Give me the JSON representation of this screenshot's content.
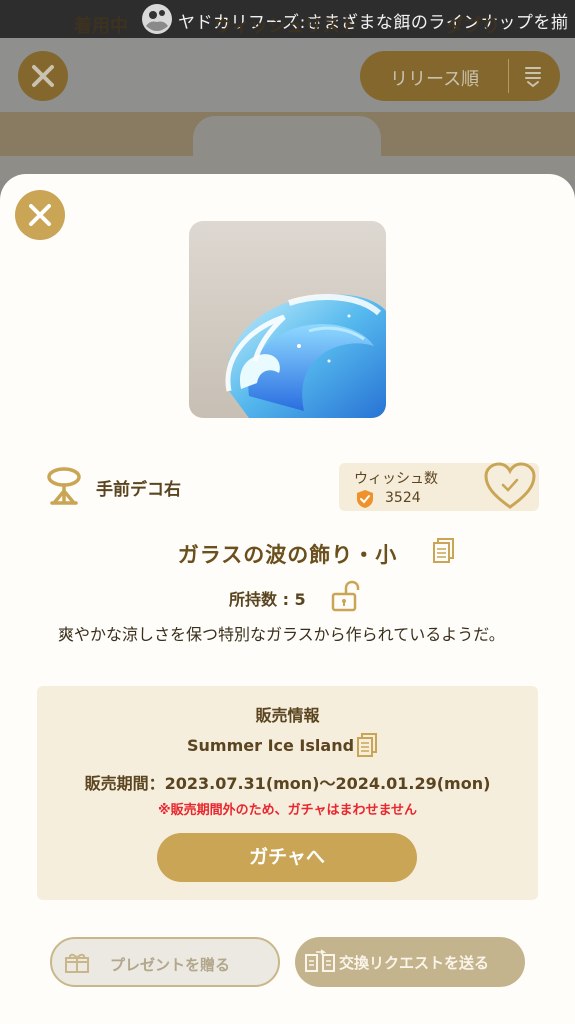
{
  "banner": {
    "text": "ヤドカリフーズ:さまざまな餌のラインナップを揃"
  },
  "background": {
    "sort_label": "リリース順",
    "tabs": [
      {
        "label": "着用中"
      },
      {
        "label": "ウィッシュリスト"
      },
      {
        "label": "ダブり"
      }
    ]
  },
  "item": {
    "category": "手前デコ右",
    "name": "ガラスの波の飾り・小",
    "owned": "所持数 : 5",
    "description": "爽やかな涼しさを保つ特別なガラスから作られているようだ。"
  },
  "wish": {
    "label": "ウィッシュ数",
    "count": "3524"
  },
  "sales": {
    "heading": "販売情報",
    "event": "Summer Ice Island",
    "period": "販売期間：2023.07.31(mon)～2024.01.29(mon)",
    "warning": "※販売期間外のため、ガチャはまわせません",
    "gacha_button": "ガチャへ"
  },
  "actions": {
    "gift": "プレゼントを贈る",
    "trade": "交換リクエストを送る"
  },
  "colors": {
    "accent": "#c9a555",
    "text_brown": "#6b4f1d",
    "warning": "#e8272e",
    "panel": "#f6eedd"
  },
  "icons": [
    "close-icon",
    "mannequin-icon",
    "heart-check-icon",
    "shield-icon",
    "copy-icon",
    "unlock-icon",
    "gift-icon",
    "exchange-icon",
    "sort-icon"
  ]
}
